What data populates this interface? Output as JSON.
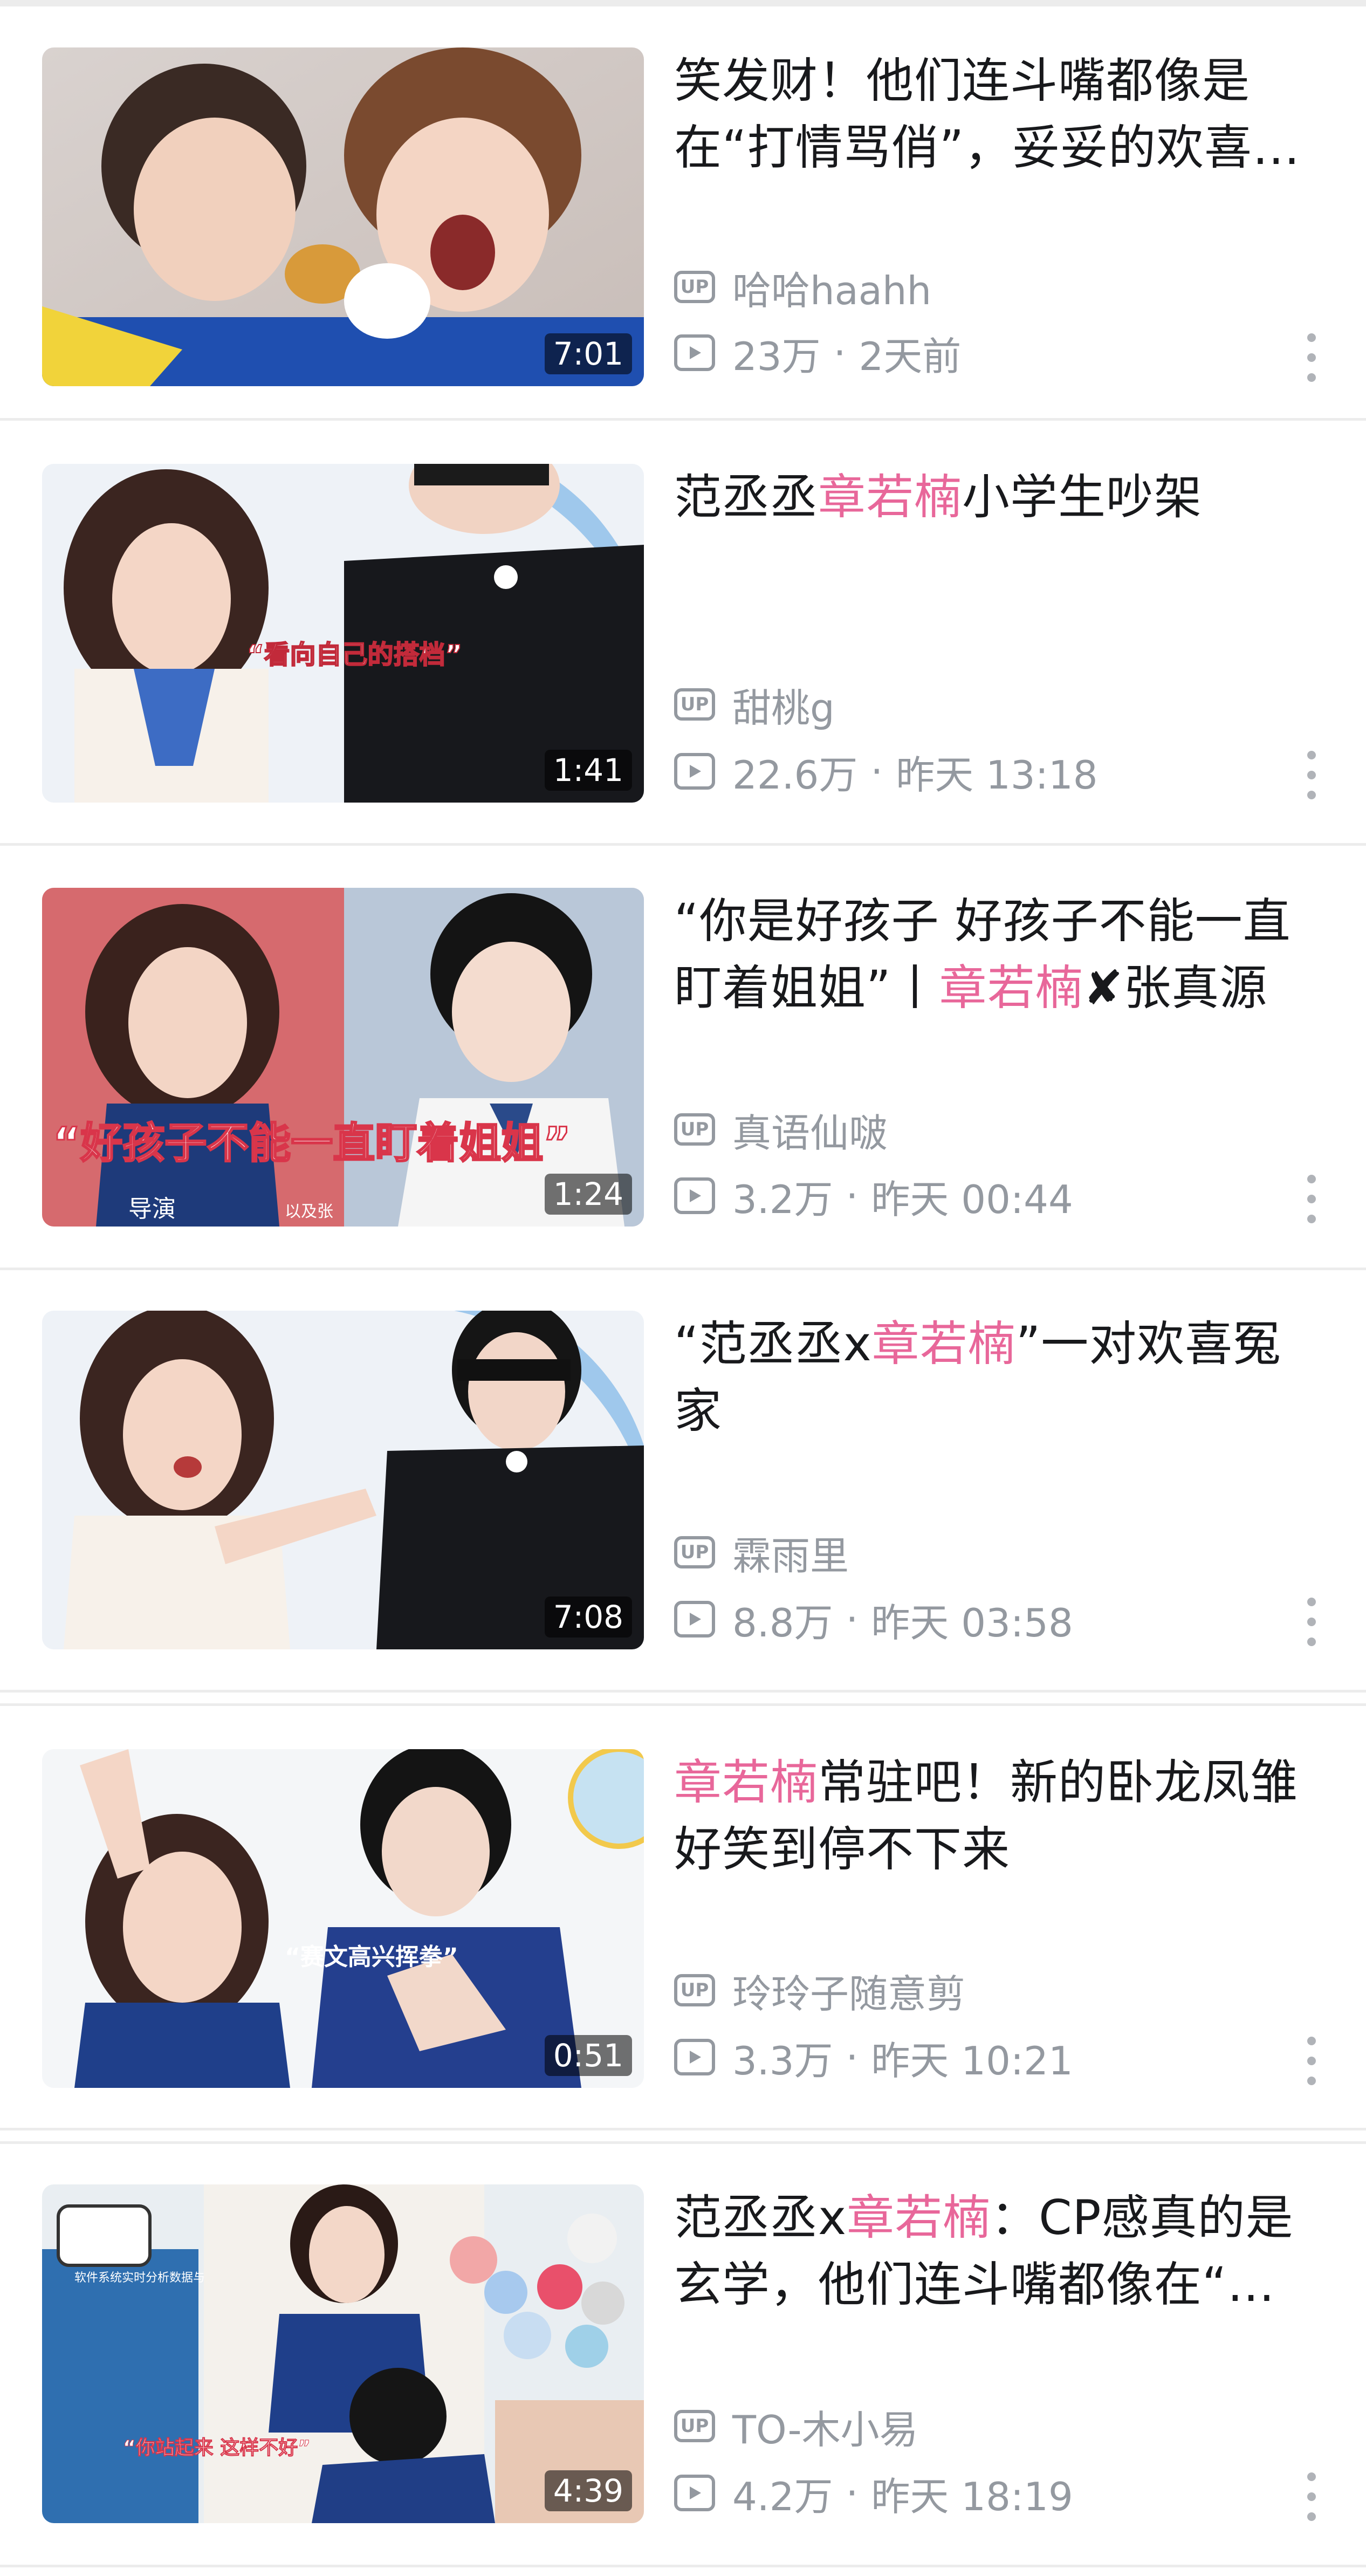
{
  "videos": [
    {
      "title_parts": [
        {
          "text": "笑发财！他们连斗嘴都像是在“打情骂俏”，妥妥的欢喜冤家",
          "highlight": false
        }
      ],
      "uploader": "哈哈haahh",
      "views": "23万",
      "time": "2天前",
      "duration": "7:01"
    },
    {
      "title_parts": [
        {
          "text": "范丞丞",
          "highlight": false
        },
        {
          "text": "章若楠",
          "highlight": true
        },
        {
          "text": "小学生吵架",
          "highlight": false
        }
      ],
      "uploader": "甜桃g",
      "views": "22.6万",
      "time": "昨天 13:18",
      "duration": "1:41"
    },
    {
      "title_parts": [
        {
          "text": "“你是好孩子 好孩子不能一直盯着姐姐”丨",
          "highlight": false
        },
        {
          "text": "章若楠",
          "highlight": true
        },
        {
          "text": "✘张真源",
          "highlight": false
        }
      ],
      "uploader": "真语仙啵",
      "views": "3.2万",
      "time": "昨天 00:44",
      "duration": "1:24"
    },
    {
      "title_parts": [
        {
          "text": "“范丞丞x",
          "highlight": false
        },
        {
          "text": "章若楠",
          "highlight": true
        },
        {
          "text": "”一对欢喜冤家",
          "highlight": false
        }
      ],
      "uploader": "霖雨里",
      "views": "8.8万",
      "time": "昨天 03:58",
      "duration": "7:08"
    },
    {
      "title_parts": [
        {
          "text": "章若楠",
          "highlight": true
        },
        {
          "text": "常驻吧！新的卧龙凤雏好笑到停不下来",
          "highlight": false
        }
      ],
      "uploader": "玲玲子随意剪",
      "views": "3.3万",
      "time": "昨天 10:21",
      "duration": "0:51"
    },
    {
      "title_parts": [
        {
          "text": "范丞丞x",
          "highlight": false
        },
        {
          "text": "章若楠",
          "highlight": true
        },
        {
          "text": "：CP感真的是玄学，他们连斗嘴都像在“打情骂俏”",
          "highlight": false
        }
      ],
      "uploader": "TO-木小易",
      "views": "4.2万",
      "time": "昨天 18:19",
      "duration": "4:39"
    }
  ],
  "labels": {
    "up_badge": "UP",
    "dot": "·"
  },
  "colors": {
    "highlight": "#e8679a",
    "meta": "#9499a0",
    "title": "#18191c",
    "separator": "#ececec"
  },
  "thumb_captions": {
    "v2": "“看向自己的搭档”",
    "v3": "“好孩子不能一直盯着姐姐”",
    "v3_small_a": "导演",
    "v3_small_b": "以及张",
    "v5": "“赛文高兴挥拳”",
    "v6": "“你站起来 这样不好”",
    "v6_sign": "软件系统实时分析数据与提供主导环境"
  }
}
